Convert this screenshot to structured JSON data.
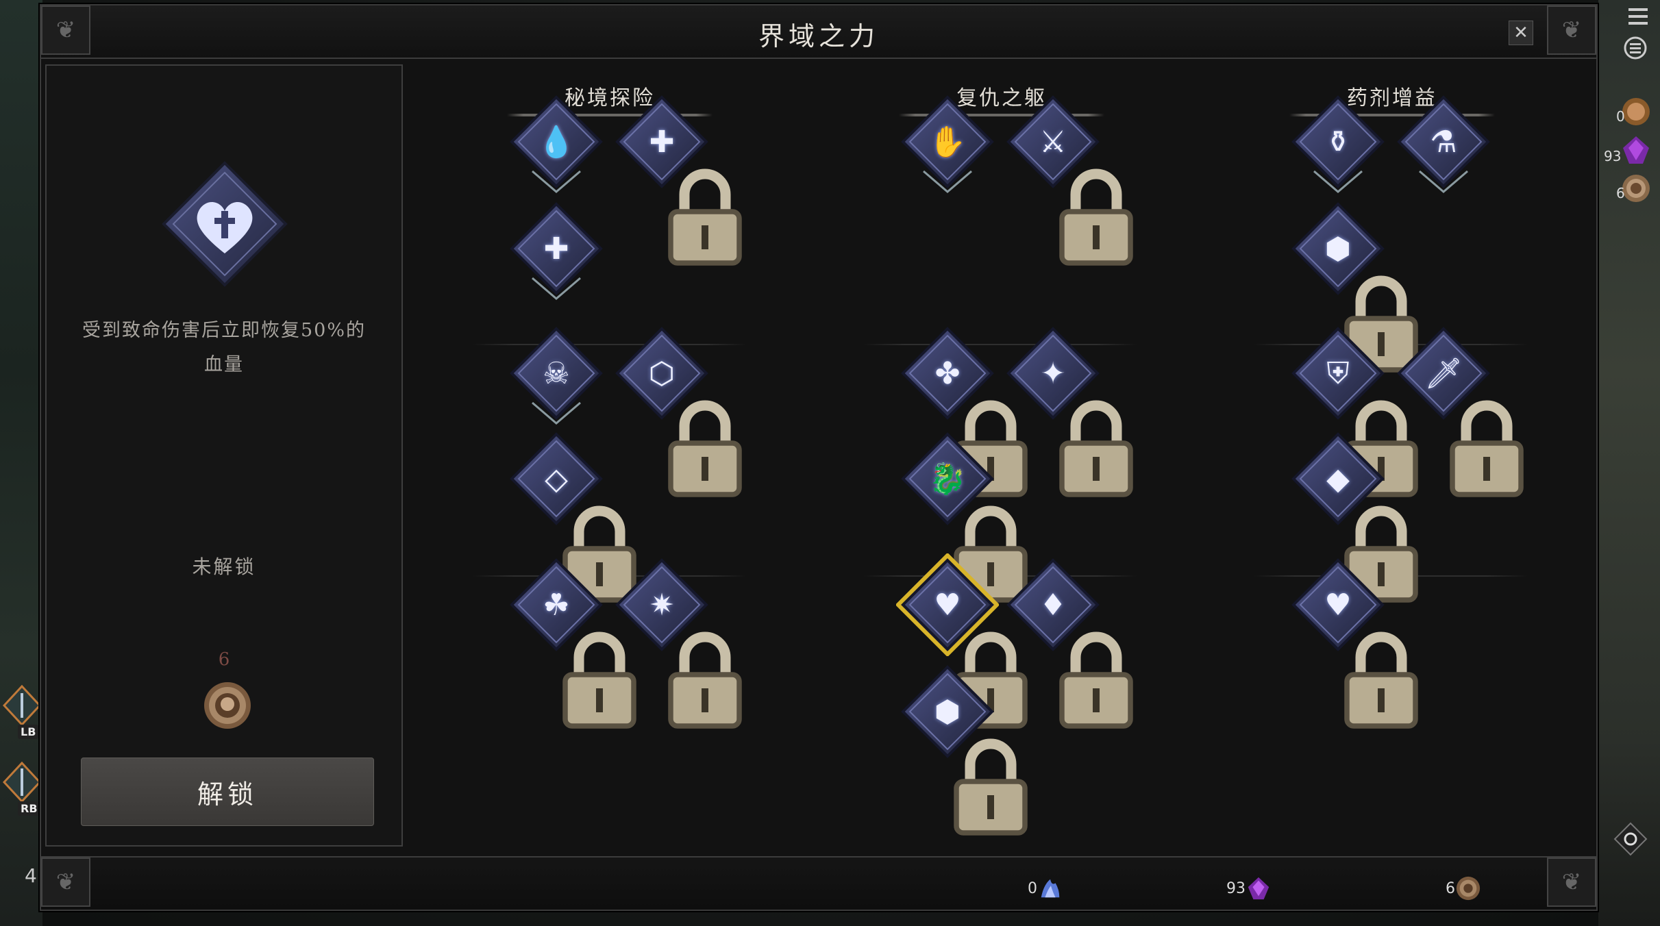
{
  "window": {
    "title": "界域之力",
    "close_label": "✕"
  },
  "detail": {
    "description": "受到致命伤害后立即恢复50%的血量",
    "status": "未解锁",
    "cost": "6",
    "unlock_label": "解锁"
  },
  "categories": [
    {
      "label": "秘境探险"
    },
    {
      "label": "复仇之躯"
    },
    {
      "label": "药剂增益"
    }
  ],
  "nodes": {
    "c1": [
      {
        "icon": "blood-drop-tablet-icon",
        "locked": false,
        "glyph": "💧"
      },
      {
        "icon": "coin-stack-plus-icon",
        "locked": true,
        "glyph": "✚"
      },
      {
        "icon": "diamond-plus-icon",
        "locked": false,
        "glyph": "✚"
      },
      {
        "icon": "demon-skull-icon",
        "locked": false,
        "glyph": "☠"
      },
      {
        "icon": "hexagon-rune-icon",
        "locked": true,
        "glyph": "⬡"
      },
      {
        "icon": "tablet-rune-icon",
        "locked": true,
        "glyph": "◇"
      },
      {
        "icon": "triquetra-amulet-icon",
        "locked": true,
        "glyph": "☘"
      },
      {
        "icon": "star-burst-icon",
        "locked": true,
        "glyph": "✷"
      }
    ],
    "c2": [
      {
        "icon": "beast-claw-icon",
        "locked": false,
        "glyph": "✋"
      },
      {
        "icon": "sword-vortex-icon",
        "locked": true,
        "glyph": "⚔"
      },
      {
        "icon": "quatrefoil-knot-icon",
        "locked": true,
        "glyph": "✤"
      },
      {
        "icon": "compass-star-icon",
        "locked": true,
        "glyph": "✦"
      },
      {
        "icon": "dragon-head-icon",
        "locked": true,
        "glyph": "🐉"
      },
      {
        "icon": "heart-cross-icon",
        "locked": true,
        "glyph": "♥",
        "selected": true
      },
      {
        "icon": "spear-tip-icon",
        "locked": true,
        "glyph": "♦"
      },
      {
        "icon": "dagger-hexagon-icon",
        "locked": true,
        "glyph": "⬢"
      }
    ],
    "c3": [
      {
        "icon": "amphora-icon",
        "locked": false,
        "glyph": "⚱"
      },
      {
        "icon": "round-potion-icon",
        "locked": false,
        "glyph": "⚗"
      },
      {
        "icon": "potion-hexagon-icon",
        "locked": true,
        "glyph": "⬢"
      },
      {
        "icon": "potion-shield-icon",
        "locked": true,
        "glyph": "⛨"
      },
      {
        "icon": "potion-sword-icon",
        "locked": true,
        "glyph": "🗡"
      },
      {
        "icon": "potion-diamonds-icon",
        "locked": true,
        "glyph": "◆"
      },
      {
        "icon": "potion-heart-icon",
        "locked": true,
        "glyph": "♥"
      }
    ]
  },
  "currency": {
    "shards": "0",
    "crystals": "93",
    "coins": "6"
  },
  "hud": {
    "shards": "0",
    "crystals": "93",
    "coins": "6",
    "lb_label": "LB",
    "rb_label": "RB",
    "left_count": "4"
  },
  "colors": {
    "selected": "#d8b42a",
    "node_fill": "#2c2f4a",
    "node_border": "#4a4e70"
  }
}
